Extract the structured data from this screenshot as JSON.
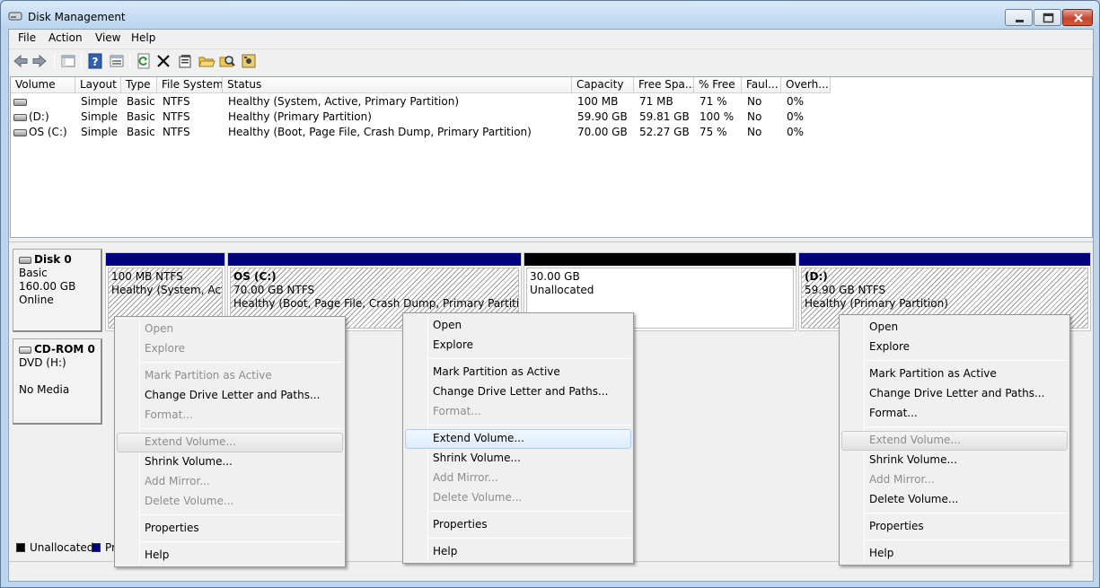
{
  "window": {
    "title": "Disk Management"
  },
  "menu": [
    "File",
    "Action",
    "View",
    "Help"
  ],
  "toolbar": {
    "buttons": [
      "back-icon",
      "forward-icon",
      "console-tree-icon",
      "help-icon",
      "disk-view-icon",
      "refresh-icon",
      "delete-icon",
      "properties-icon",
      "open-icon",
      "explore-icon",
      "settings-icon"
    ]
  },
  "volume_table": {
    "columns": [
      "Volume",
      "Layout",
      "Type",
      "File System",
      "Status",
      "Capacity",
      "Free Spa...",
      "% Free",
      "Faul...",
      "Overh..."
    ],
    "rows": [
      {
        "volume": "",
        "layout": "Simple",
        "type": "Basic",
        "fs": "NTFS",
        "status": "Healthy (System, Active, Primary Partition)",
        "capacity": "100 MB",
        "free": "71 MB",
        "pct_free": "71 %",
        "fault": "No",
        "overhead": "0%"
      },
      {
        "volume": "(D:)",
        "layout": "Simple",
        "type": "Basic",
        "fs": "NTFS",
        "status": "Healthy (Primary Partition)",
        "capacity": "59.90 GB",
        "free": "59.81 GB",
        "pct_free": "100 %",
        "fault": "No",
        "overhead": "0%"
      },
      {
        "volume": "OS (C:)",
        "layout": "Simple",
        "type": "Basic",
        "fs": "NTFS",
        "status": "Healthy (Boot, Page File, Crash Dump, Primary Partition)",
        "capacity": "70.00 GB",
        "free": "52.27 GB",
        "pct_free": "75 %",
        "fault": "No",
        "overhead": "0%"
      }
    ]
  },
  "disks": [
    {
      "name": "Disk 0",
      "type": "Basic",
      "size": "160.00 GB",
      "state": "Online"
    },
    {
      "name": "CD-ROM 0",
      "type": "DVD (H:)",
      "size": "",
      "state": "No Media"
    }
  ],
  "partitions": [
    {
      "name": "",
      "size": "100 MB NTFS",
      "status": "Healthy (System, Active, Primary Partition)"
    },
    {
      "name": "OS  (C:)",
      "size": "70.00 GB NTFS",
      "status": "Healthy (Boot, Page File, Crash Dump, Primary Partition)"
    },
    {
      "name": "",
      "size": "30.00 GB",
      "status": "Unallocated"
    },
    {
      "name": "(D:)",
      "size": "59.90 GB NTFS",
      "status": "Healthy (Primary Partition)"
    }
  ],
  "legend": [
    {
      "label": "Unallocated",
      "color": "#000000"
    },
    {
      "label": "Pr",
      "color": "#000080"
    }
  ],
  "colors": {
    "primary_partition": "#000080",
    "unallocated": "#000000"
  },
  "context_menus": [
    {
      "items": [
        {
          "label": "Open",
          "enabled": false
        },
        {
          "label": "Explore",
          "enabled": false
        },
        {
          "sep": true
        },
        {
          "label": "Mark Partition as Active",
          "enabled": false
        },
        {
          "label": "Change Drive Letter and Paths...",
          "enabled": true
        },
        {
          "label": "Format...",
          "enabled": false
        },
        {
          "sep": true
        },
        {
          "label": "Extend Volume...",
          "enabled": false,
          "highlight": true
        },
        {
          "label": "Shrink Volume...",
          "enabled": true
        },
        {
          "label": "Add Mirror...",
          "enabled": false
        },
        {
          "label": "Delete Volume...",
          "enabled": false
        },
        {
          "sep": true
        },
        {
          "label": "Properties",
          "enabled": true
        },
        {
          "sep": true
        },
        {
          "label": "Help",
          "enabled": true
        }
      ]
    },
    {
      "items": [
        {
          "label": "Open",
          "enabled": true
        },
        {
          "label": "Explore",
          "enabled": true
        },
        {
          "sep": true
        },
        {
          "label": "Mark Partition as Active",
          "enabled": true
        },
        {
          "label": "Change Drive Letter and Paths...",
          "enabled": true
        },
        {
          "label": "Format...",
          "enabled": false
        },
        {
          "sep": true
        },
        {
          "label": "Extend Volume...",
          "enabled": true,
          "highlight": true
        },
        {
          "label": "Shrink Volume...",
          "enabled": true
        },
        {
          "label": "Add Mirror...",
          "enabled": false
        },
        {
          "label": "Delete Volume...",
          "enabled": false
        },
        {
          "sep": true
        },
        {
          "label": "Properties",
          "enabled": true
        },
        {
          "sep": true
        },
        {
          "label": "Help",
          "enabled": true
        }
      ]
    },
    {
      "items": [
        {
          "label": "Open",
          "enabled": true
        },
        {
          "label": "Explore",
          "enabled": true
        },
        {
          "sep": true
        },
        {
          "label": "Mark Partition as Active",
          "enabled": true
        },
        {
          "label": "Change Drive Letter and Paths...",
          "enabled": true
        },
        {
          "label": "Format...",
          "enabled": true
        },
        {
          "sep": true
        },
        {
          "label": "Extend Volume...",
          "enabled": false,
          "highlight": true
        },
        {
          "label": "Shrink Volume...",
          "enabled": true
        },
        {
          "label": "Add Mirror...",
          "enabled": false
        },
        {
          "label": "Delete Volume...",
          "enabled": true
        },
        {
          "sep": true
        },
        {
          "label": "Properties",
          "enabled": true
        },
        {
          "sep": true
        },
        {
          "label": "Help",
          "enabled": true
        }
      ]
    }
  ]
}
